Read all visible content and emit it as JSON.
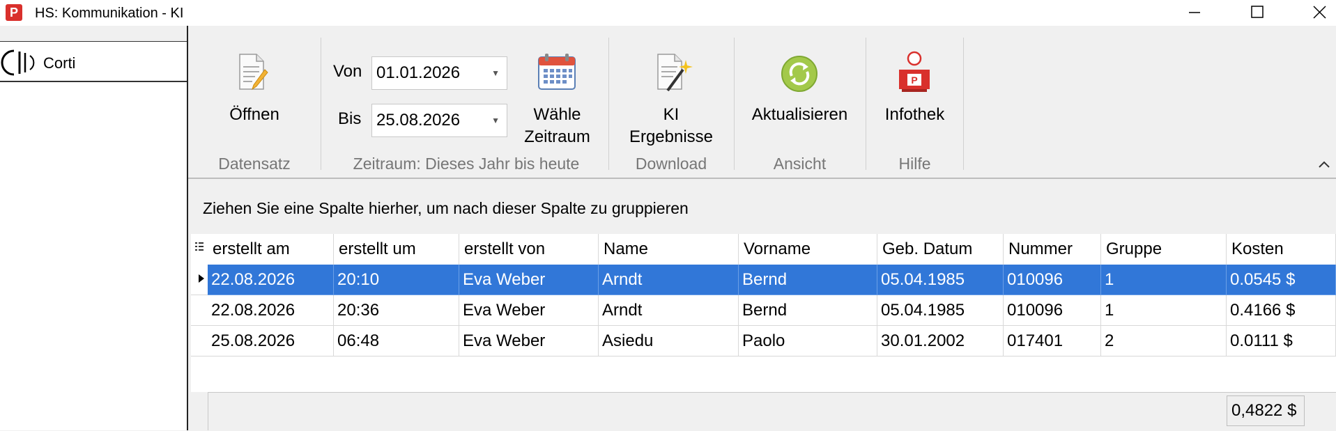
{
  "window": {
    "title": "HS: Kommunikation - KI",
    "app_icon_letter": "P"
  },
  "sidebar": {
    "item_label": "Corti"
  },
  "ribbon": {
    "open_label": "Öffnen",
    "from_label": "Von",
    "from_value": "01.01.2026",
    "to_label": "Bis",
    "to_value": "25.08.2026",
    "choose_period_line1": "Wähle",
    "choose_period_line2": "Zeitraum",
    "ki_results_line1": "KI",
    "ki_results_line2": "Ergebnisse",
    "refresh_label": "Aktualisieren",
    "infothek_label": "Infothek",
    "groups": {
      "datensatz": "Datensatz",
      "zeitraum": "Zeitraum: Dieses Jahr bis heute",
      "download": "Download",
      "ansicht": "Ansicht",
      "hilfe": "Hilfe"
    }
  },
  "grid": {
    "group_hint": "Ziehen Sie eine Spalte hierher, um nach dieser Spalte zu gruppieren",
    "columns": [
      "erstellt am",
      "erstellt um",
      "erstellt von",
      "Name",
      "Vorname",
      "Geb. Datum",
      "Nummer",
      "Gruppe",
      "Kosten"
    ],
    "rows": [
      [
        "22.08.2026",
        "20:10",
        "Eva Weber",
        "Arndt",
        "Bernd",
        "05.04.1985",
        "010096",
        "1",
        "0.0545 $"
      ],
      [
        "22.08.2026",
        "20:36",
        "Eva Weber",
        "Arndt",
        "Bernd",
        "05.04.1985",
        "010096",
        "1",
        "0.4166 $"
      ],
      [
        "25.08.2026",
        "06:48",
        "Eva Weber",
        "Asiedu",
        "Paolo",
        "30.01.2002",
        "017401",
        "2",
        "0.0111 $"
      ]
    ],
    "selected_row": 0,
    "total": "0,4822 $"
  },
  "colors": {
    "selection": "#3177d8",
    "app_icon": "#d9302c"
  }
}
